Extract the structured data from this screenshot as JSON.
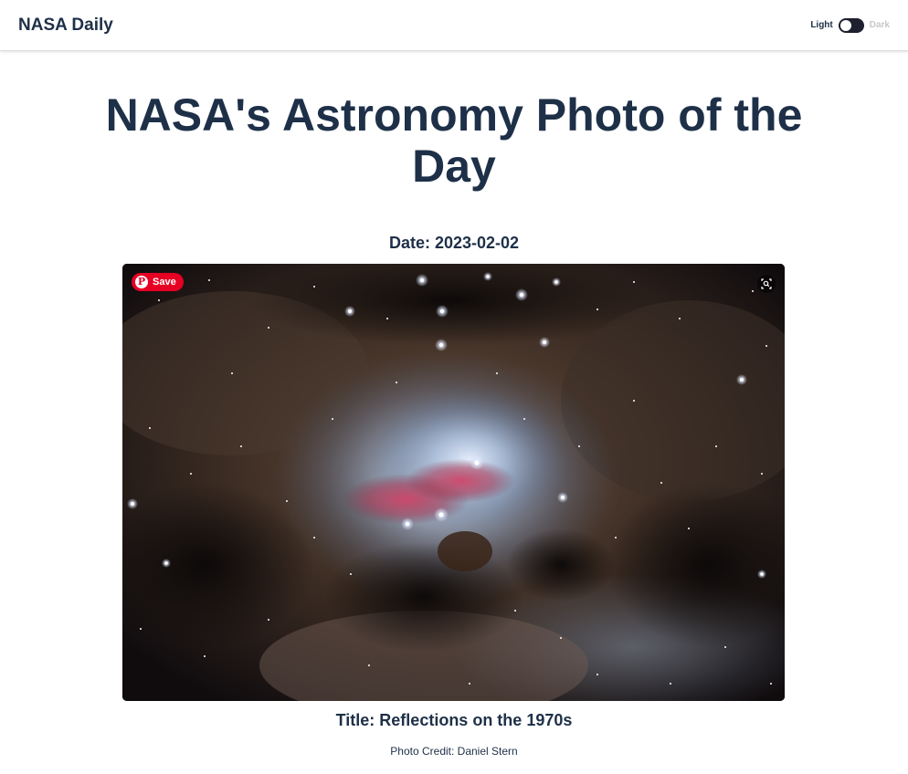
{
  "navbar": {
    "brand": "NASA Daily",
    "theme_light_label": "Light",
    "theme_dark_label": "Dark",
    "theme_toggle_state": "light"
  },
  "page": {
    "heading": "NASA's Astronomy Photo of the Day",
    "date_text": "Date: 2023-02-02",
    "title_text": "Title: Reflections on the 1970s",
    "credit_text": "Photo Credit: Daniel Stern"
  },
  "image_overlay": {
    "save_label": "Save",
    "save_logo": "P",
    "lens_icon": "visual-search-icon"
  },
  "colors": {
    "text": "#1e3048",
    "save_button": "#e60023",
    "toggle_track": "#1e2030"
  }
}
